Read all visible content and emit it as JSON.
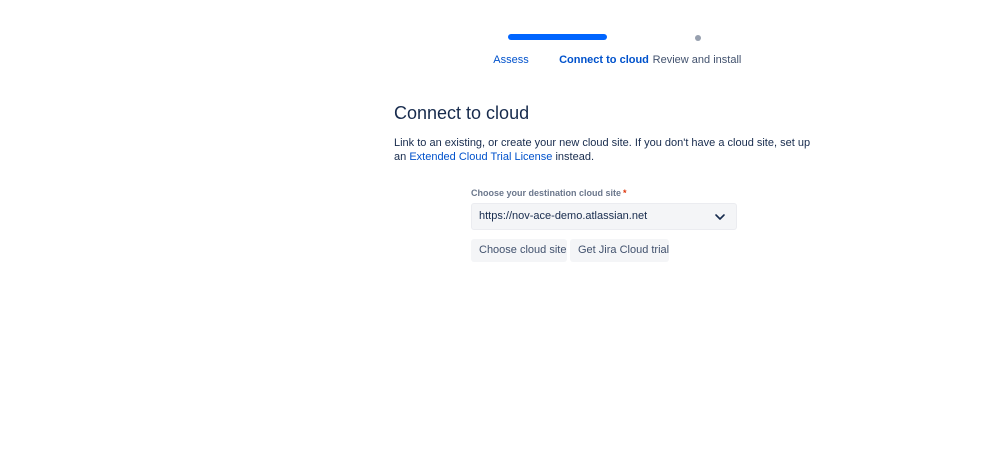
{
  "tracker": {
    "steps": [
      {
        "label": "Assess",
        "state": "completed"
      },
      {
        "label": "Connect to cloud",
        "state": "current"
      },
      {
        "label": "Review and install",
        "state": "upcoming"
      }
    ],
    "colors": {
      "active": "#0065ff",
      "inactive": "#97a0af"
    }
  },
  "main": {
    "title": "Connect to cloud",
    "description_prefix": "Link to an existing, or create your new cloud site. If you don't have a cloud site, set up an",
    "description_link": "Extended Cloud Trial License",
    "description_suffix": "instead.",
    "field": {
      "label": "Choose your destination cloud site",
      "required_marker": "*",
      "value": "https://nov-ace-demo.atlassian.net",
      "icon": "chevron-down-icon"
    },
    "buttons": {
      "choose_label": "Choose cloud site",
      "trial_label": "Get Jira Cloud trial"
    }
  }
}
